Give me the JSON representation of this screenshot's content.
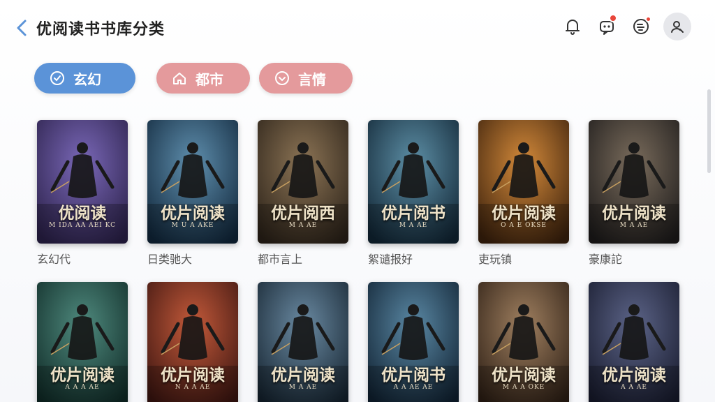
{
  "header": {
    "title": "优阅读书书库分类",
    "icons": [
      "back-icon",
      "bell-icon",
      "chat-bot-icon",
      "message-icon",
      "user-icon"
    ],
    "accent": "#5b93d8",
    "badge_color": "#e8463a"
  },
  "filters": [
    {
      "label": "玄幻",
      "icon": "check-circle-icon",
      "active": true,
      "color": "#5b93d8"
    },
    {
      "label": "都市",
      "icon": "home-icon",
      "active": false,
      "color": "#e49a9c"
    },
    {
      "label": "言情",
      "icon": "chevron-circle-icon",
      "active": false,
      "color": "#e49a9c"
    }
  ],
  "books": [
    {
      "cover_title": "优阅读",
      "cover_sub": "M IDA AA AEI KC",
      "name": "玄幻代",
      "palette": [
        "#2a2048",
        "#7a68b8"
      ]
    },
    {
      "cover_title": "优片阅读",
      "cover_sub": "M U A AKE",
      "name": "日类驰大",
      "palette": [
        "#10263a",
        "#5f8fae"
      ]
    },
    {
      "cover_title": "优片阅西",
      "cover_sub": "M A AE",
      "name": "都市言上",
      "palette": [
        "#2a2118",
        "#8c7455"
      ]
    },
    {
      "cover_title": "优片阅书",
      "cover_sub": "M A AE",
      "name": "絮谴报好",
      "palette": [
        "#102433",
        "#5d8fa6"
      ]
    },
    {
      "cover_title": "优片阅读",
      "cover_sub": "O A E OKSE",
      "name": "吏玩镇",
      "palette": [
        "#3a200c",
        "#d48a3a"
      ]
    },
    {
      "cover_title": "优片阅读",
      "cover_sub": "M A AE",
      "name": "豪康詑",
      "palette": [
        "#1c1a1a",
        "#7a6c5c"
      ]
    },
    {
      "cover_title": "优片阅读",
      "cover_sub": "A A A AE",
      "name": "",
      "palette": [
        "#0f2a26",
        "#4f8a7e"
      ]
    },
    {
      "cover_title": "优片阅读",
      "cover_sub": "N A A AE",
      "name": "",
      "palette": [
        "#3a1410",
        "#c45a3a"
      ]
    },
    {
      "cover_title": "优片阅读",
      "cover_sub": "M A AE",
      "name": "",
      "palette": [
        "#14222e",
        "#6a8aa2"
      ]
    },
    {
      "cover_title": "优片阅书",
      "cover_sub": "A A AE AE",
      "name": "",
      "palette": [
        "#0f2030",
        "#5a88a4"
      ]
    },
    {
      "cover_title": "优片阅读",
      "cover_sub": "M A A OKE",
      "name": "",
      "palette": [
        "#2c1e14",
        "#a08060"
      ]
    },
    {
      "cover_title": "优片阅读",
      "cover_sub": "A A AE",
      "name": "",
      "palette": [
        "#171a2c",
        "#5c6488"
      ]
    }
  ]
}
